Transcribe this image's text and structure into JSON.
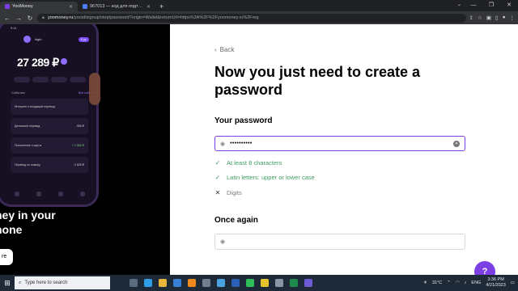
{
  "browser": {
    "tabs": [
      {
        "title": "YooMoney",
        "active": true,
        "favicon_color": "#7b3fe4"
      },
      {
        "title": "967013 — код для подтвержде",
        "active": false,
        "favicon_color": "#4d7cff"
      }
    ],
    "new_tab": "+",
    "url_domain": "yoomoney.ru",
    "url_path": "/yooid/signup/step/password?origin=Wallet&returnUrl=https%3A%2F%2Fyoomoney.ru%2Freg"
  },
  "phone": {
    "time": "9:41",
    "login": "login",
    "badge": "6 ур",
    "balance": "27 289 ₽",
    "events_label": "События",
    "all_label": "Все события",
    "cards": [
      {
        "name": "Интернет и входящий перевод",
        "amount": ""
      },
      {
        "name": "Денежный перевод",
        "amount": "- 900 ₽"
      },
      {
        "name": "Пополнение с карты",
        "amount": "+ 1 500 ₽"
      },
      {
        "name": "Перевод по номеру",
        "amount": "- 2 620 ₽"
      }
    ]
  },
  "promo": {
    "line1": "ney in your",
    "line2": "hone",
    "button": "re"
  },
  "form": {
    "back_label": "Back",
    "heading": "Now you just need to create a password",
    "password_label": "Your password",
    "password_value": "••••••••••",
    "rules": [
      {
        "text": "At least 8 characters",
        "ok": true
      },
      {
        "text": "Latin letters: upper or lower case",
        "ok": true
      },
      {
        "text": "Digits",
        "ok": false
      }
    ],
    "confirm_label": "Once again",
    "confirm_value": "",
    "help_label": "?"
  },
  "colors": {
    "accent": "#7b3fe4",
    "ok_green": "#3f9c62"
  },
  "taskbar": {
    "search_placeholder": "Type here to search",
    "weather": "31°C",
    "language": "ENG",
    "time": "3:36 PM",
    "date": "4/21/2023"
  }
}
